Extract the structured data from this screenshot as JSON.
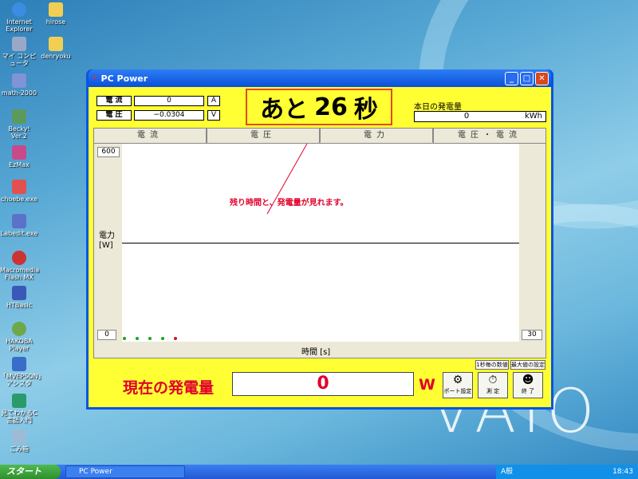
{
  "desktop": {
    "icons": [
      {
        "label": "Internet Explorer",
        "color": "#3a8de0"
      },
      {
        "label": "hirose",
        "color": "#f2cf52"
      },
      {
        "label": "マイ コンピュータ",
        "color": "#9aa8c8"
      },
      {
        "label": "denryoku",
        "color": "#f2cf52"
      },
      {
        "label": "math-2000",
        "color": "#7f94d6"
      },
      {
        "label": "Becky! Ver.2",
        "color": "#5b9a5b"
      },
      {
        "label": "EzMax",
        "color": "#c84a8a"
      },
      {
        "label": "choebe.exe",
        "color": "#e35050"
      },
      {
        "label": "Labedit.exe",
        "color": "#5b72c9"
      },
      {
        "label": "Macromedia Flash MX",
        "color": "#cc3333"
      },
      {
        "label": "HTBasic",
        "color": "#3a58b8"
      },
      {
        "label": "HAKOBA Player",
        "color": "#6da94a"
      },
      {
        "label": "「MVEPSON」アシスタ",
        "color": "#3a6dc9"
      },
      {
        "label": "見てわかるC言語入門",
        "color": "#2a9a6a"
      },
      {
        "label": "ごみ箱",
        "color": "#9cbcd6"
      }
    ],
    "brand": "VAIO"
  },
  "window": {
    "title": "PC Power",
    "minimize_glyph": "_",
    "maximize_glyph": "□",
    "close_glyph": "✕"
  },
  "readings": {
    "current_label": "電 流",
    "current_value": "0",
    "current_unit": "A",
    "voltage_label": "電 圧",
    "voltage_value": "−0.0304",
    "voltage_unit": "V"
  },
  "countdown": {
    "prefix": "あと",
    "seconds": "26",
    "suffix": "秒"
  },
  "today": {
    "label": "本日の発電量",
    "value": "0",
    "unit": "kWh"
  },
  "tabs": [
    {
      "label": "電流",
      "active": false
    },
    {
      "label": "電圧",
      "active": false
    },
    {
      "label": "電力",
      "active": true
    },
    {
      "label": "電圧・電流",
      "active": false
    }
  ],
  "graph": {
    "y_max": "600",
    "y_min": "0",
    "x_max": "30",
    "y_label": "電力\n[W]",
    "x_label": "時間 [s]",
    "annotation": "残り時間と、発電量が見れます。"
  },
  "settings_buttons": {
    "per_second": "1秒毎の数値",
    "max_setting": "最大値の設定"
  },
  "current_output": {
    "label": "現在の発電量",
    "value": "0",
    "unit": "W"
  },
  "actions": {
    "port_setting": "ポート設定",
    "measure": "測 定",
    "exit": "終 了"
  },
  "taskbar": {
    "start_label": "スタート",
    "task": "PC Power",
    "ime": "A般",
    "clock": "18:43"
  }
}
